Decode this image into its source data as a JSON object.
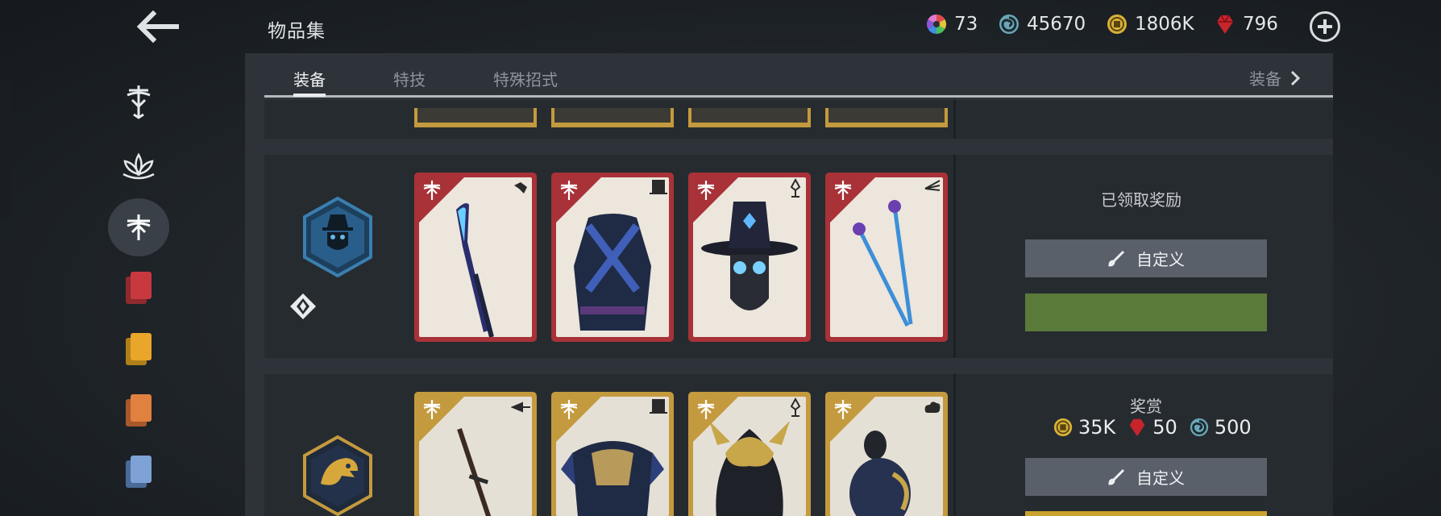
{
  "header": {
    "title": "物品集",
    "currencies": [
      {
        "icon": "rainbow-wheel-icon",
        "value": "73"
      },
      {
        "icon": "spirit-swirl-icon",
        "value": "45670"
      },
      {
        "icon": "gold-coin-icon",
        "value": "1806K"
      },
      {
        "icon": "ruby-gem-icon",
        "value": "796"
      }
    ]
  },
  "tabs": [
    {
      "label": "装备",
      "active": true
    },
    {
      "label": "特技",
      "active": false
    },
    {
      "label": "特殊招式",
      "active": false
    }
  ],
  "tab_more_label": "装备",
  "sidebar": {
    "items": [
      {
        "icon": "dragonfly-crest-icon",
        "active": false
      },
      {
        "icon": "lotus-icon",
        "active": false
      },
      {
        "icon": "dragonfly-icon",
        "active": true
      },
      {
        "icon": "red-cards-icon",
        "active": false
      },
      {
        "icon": "yellow-cards-icon",
        "active": false
      },
      {
        "icon": "orange-cards-icon",
        "active": false
      },
      {
        "icon": "blue-cards-icon",
        "active": false
      }
    ]
  },
  "sets": [
    {
      "emblem": "plague-doctor-emblem-icon",
      "rarity": "epic",
      "status": "已领取奖励",
      "customize_label": "自定义",
      "items": [
        {
          "name": "glaive-weapon",
          "type_icon": "weapon-type-icon"
        },
        {
          "name": "armor-body",
          "type_icon": "armor-type-icon"
        },
        {
          "name": "hat-mask-helm",
          "type_icon": "helm-type-icon"
        },
        {
          "name": "twin-spears-ranged",
          "type_icon": "ranged-type-icon"
        }
      ]
    },
    {
      "emblem": "eagle-emblem-icon",
      "rarity": "legendary",
      "reward_title": "奖赏",
      "rewards": [
        {
          "icon": "gold-coin-icon",
          "value": "35K"
        },
        {
          "icon": "ruby-gem-icon",
          "value": "50"
        },
        {
          "icon": "spirit-swirl-icon",
          "value": "500"
        }
      ],
      "customize_label": "自定义",
      "items": [
        {
          "name": "katana-weapon",
          "type_icon": "weapon-type-icon"
        },
        {
          "name": "samurai-armor",
          "type_icon": "armor-type-icon"
        },
        {
          "name": "golden-helm",
          "type_icon": "helm-type-icon"
        },
        {
          "name": "gourd-magic",
          "type_icon": "magic-type-icon"
        }
      ]
    }
  ],
  "colors": {
    "epic_frame": "#a83238",
    "legendary_frame": "#c49a3e",
    "claim_green": "#5a7a3a",
    "button_gray": "#5a606a"
  }
}
